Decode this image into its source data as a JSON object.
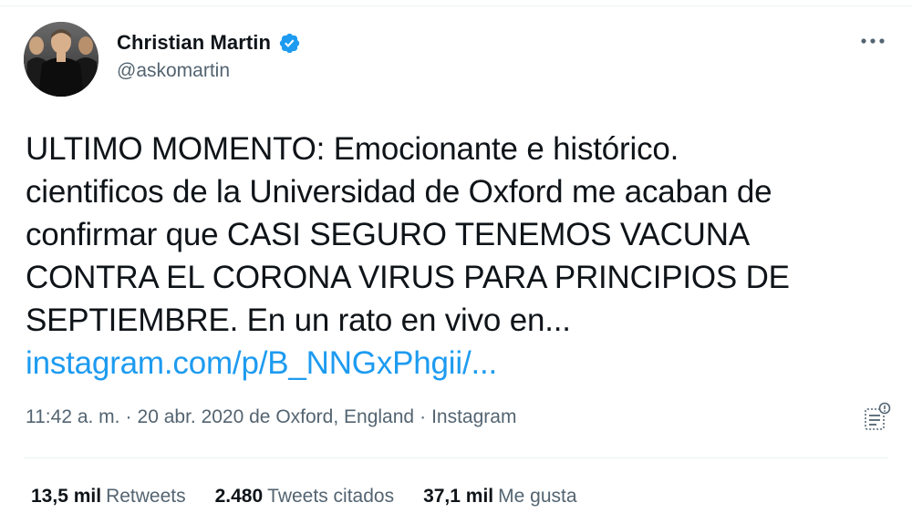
{
  "author": {
    "display_name": "Christian Martin",
    "handle": "@askomartin",
    "verified_icon": "verified-badge-icon",
    "avatar": "profile-photo"
  },
  "menu": {
    "icon": "more-options-icon"
  },
  "tweet": {
    "text_lines": [
      "ULTIMO MOMENTO: Emocionante e histórico.",
      "cientificos de la Universidad de Oxford me acaban de",
      "confirmar que CASI SEGURO TENEMOS VACUNA",
      "CONTRA EL CORONA VIRUS PARA PRINCIPIOS DE",
      "SEPTIEMBRE. En un rato en vivo en..."
    ],
    "link_text": "instagram.com/p/B_NNGxPhgii/..."
  },
  "meta": {
    "time": "11:42 a. m.",
    "separator": "·",
    "date_location": "20 abr. 2020 de Oxford, England",
    "source": "Instagram",
    "analytics_icon": "analytics-icon"
  },
  "stats": {
    "retweets_count": "13,5 mil",
    "retweets_label": "Retweets",
    "quotes_count": "2.480",
    "quotes_label": "Tweets citados",
    "likes_count": "37,1 mil",
    "likes_label": "Me gusta"
  },
  "colors": {
    "link": "#1d9bf0",
    "secondary_text": "#536471",
    "primary_text": "#0f1419",
    "verified": "#1d9bf0"
  }
}
